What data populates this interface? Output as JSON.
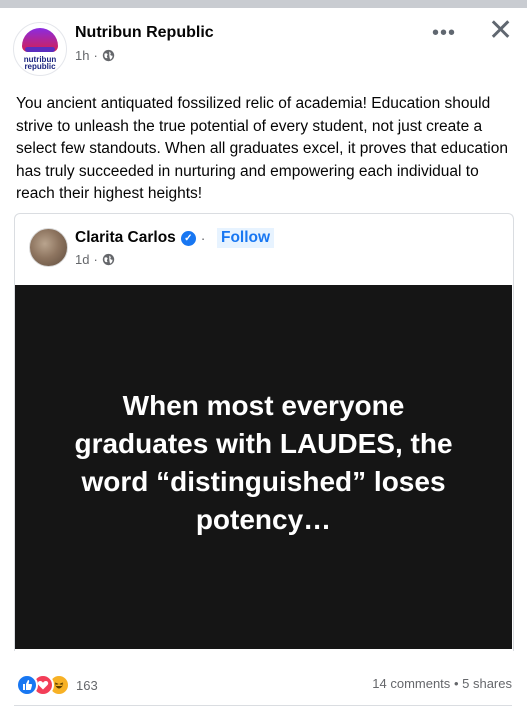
{
  "post": {
    "page_name": "Nutribun Republic",
    "avatar_line1": "nutribun",
    "avatar_line2": "republic",
    "time": "1h",
    "separator": "·",
    "body": "You ancient antiquated fossilized relic of academia! Education should strive to unleash the true potential of every student, not just create a select few standouts. When all graduates excel, it proves that education has truly succeeded in nurturing and empowering each individual to reach their highest heights!",
    "more_icon": "more-options-icon",
    "close_icon": "close-icon"
  },
  "shared": {
    "author": "Clarita Carlos",
    "follow_label": "Follow",
    "separator": "·",
    "time": "1d",
    "image_text": "When most everyone graduates with LAUDES, the word “distinguished” loses potency…"
  },
  "footer": {
    "reaction_count": "163",
    "comments": "14 comments",
    "separator": "•",
    "shares": "5 shares",
    "reactions": [
      "like-icon",
      "love-icon",
      "haha-icon"
    ]
  },
  "colors": {
    "accent": "#1877f2",
    "secondary_text": "#65676b",
    "image_bg": "#151515"
  }
}
